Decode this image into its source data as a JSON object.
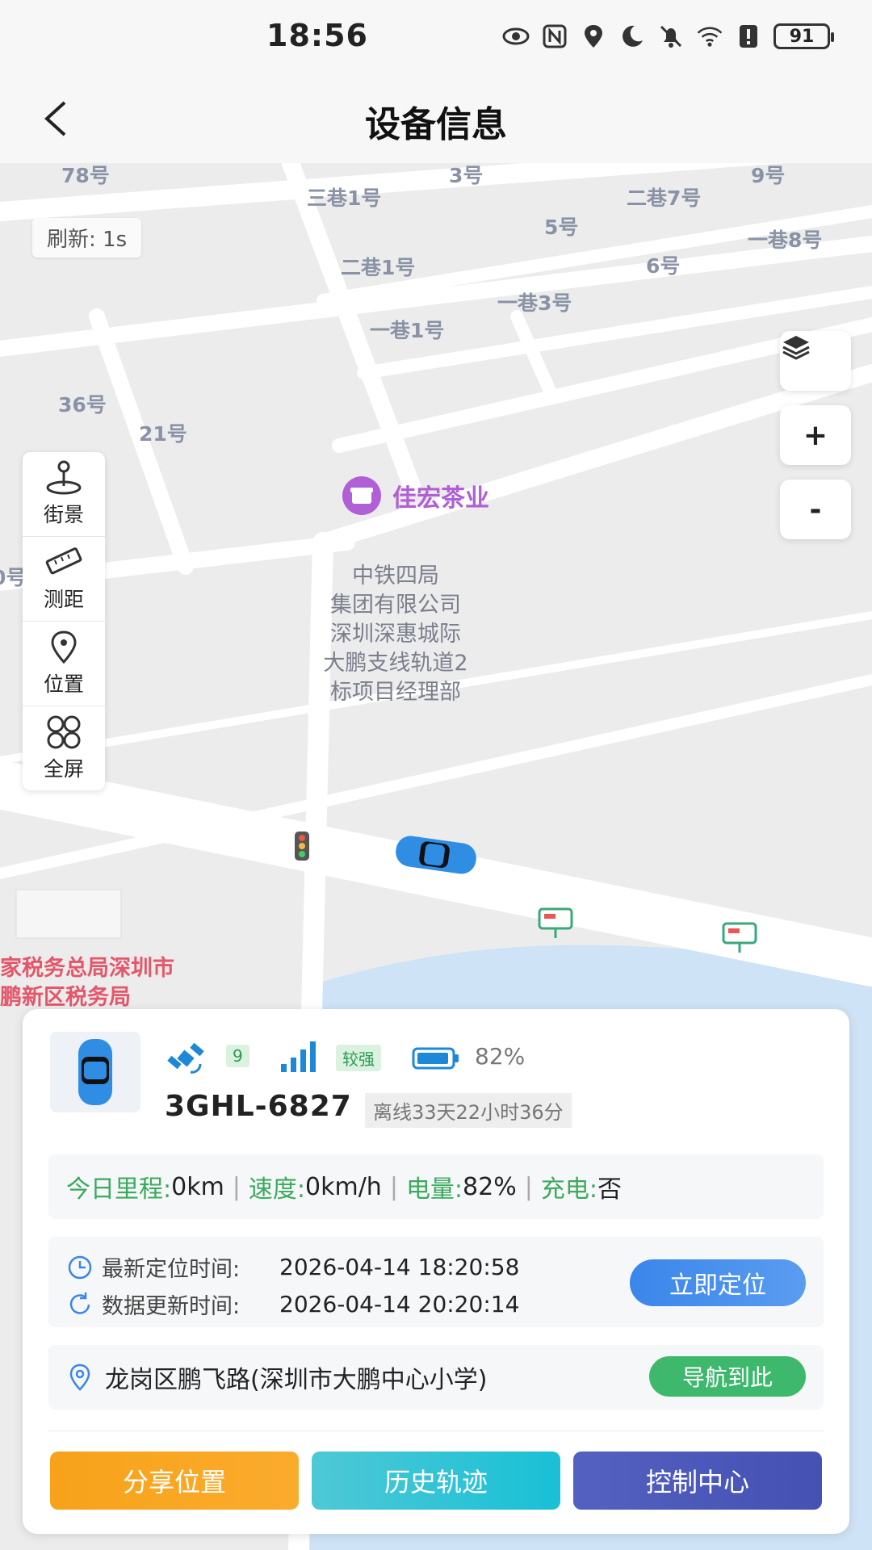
{
  "status_bar": {
    "time": "18:56",
    "battery": "91"
  },
  "header": {
    "title": "设备信息"
  },
  "map": {
    "refresh_label": "刷新: 1s",
    "street_labels": [
      "78号",
      "三巷1号",
      "3号",
      "二巷7号",
      "9号",
      "5号",
      "一巷8号",
      "二巷1号",
      "6号",
      "一巷3号",
      "一巷1号",
      "36号",
      "21号",
      "0号"
    ],
    "poi_name": "佳宏茶业",
    "poi_block": [
      "中铁四局",
      "集团有限公司",
      "深圳深惠城际",
      "大鹏支线轨道2",
      "标项目经理部"
    ],
    "tax_office": [
      "家税务总局深圳市",
      "鹏新区税务局"
    ],
    "tools": [
      {
        "label": "街景",
        "icon": "street-view-icon"
      },
      {
        "label": "测距",
        "icon": "ruler-icon"
      },
      {
        "label": "位置",
        "icon": "location-pin-icon"
      },
      {
        "label": "全屏",
        "icon": "fullscreen-icon"
      }
    ],
    "zoom_in": "+",
    "zoom_out": "-"
  },
  "device": {
    "satellites": "9",
    "signal": "较强",
    "battery_pct": "82%",
    "plate": "3GHL-6827",
    "offline": "离线33天22小时36分",
    "stats": [
      {
        "k": "今日里程:",
        "v": "0km"
      },
      {
        "k": "速度:",
        "v": "0km/h"
      },
      {
        "k": "电量:",
        "v": "82%"
      },
      {
        "k": "充电:",
        "v": "否"
      }
    ],
    "loc_time_label": "最新定位时间:",
    "loc_time": "2026-04-14 18:20:58",
    "update_time_label": "数据更新时间:",
    "update_time": "2026-04-14 20:20:14",
    "locate_btn": "立即定位",
    "address": "龙岗区鹏飞路(深圳市大鹏中心小学)",
    "nav_btn": "导航到此",
    "actions": [
      "分享位置",
      "历史轨迹",
      "控制中心"
    ]
  },
  "colors": {
    "green": "#3aaa5c",
    "blue": "#3a86ea",
    "orange": "#f7a21a",
    "cyan": "#1ec3d6",
    "indigo": "#4b56b8"
  }
}
